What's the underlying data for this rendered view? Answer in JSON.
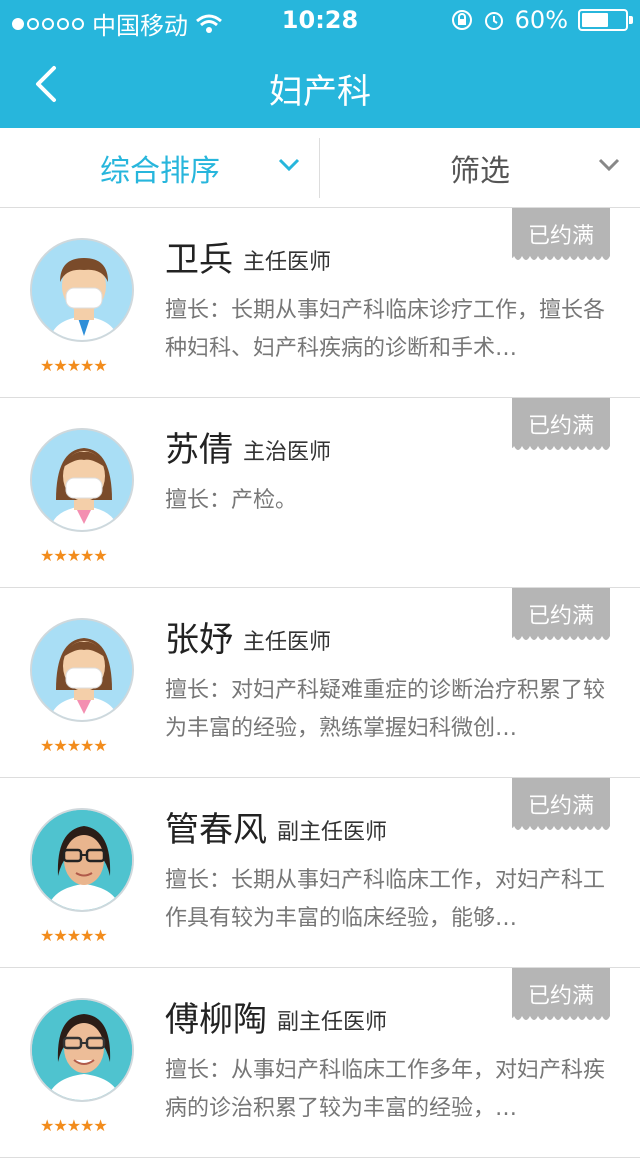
{
  "status_bar": {
    "carrier": "中国移动",
    "time": "10:28",
    "battery": "60%"
  },
  "nav": {
    "title": "妇产科"
  },
  "filters": {
    "sort_label": "综合排序",
    "filter_label": "筛选"
  },
  "doctors": [
    {
      "name": "卫兵",
      "rank": "主任医师",
      "skill": "擅长：长期从事妇产科临床诊疗工作，擅长各种妇科、妇产科疾病的诊断和手术…",
      "badge": "已约满",
      "stars": "★★★★★"
    },
    {
      "name": "苏倩",
      "rank": "主治医师",
      "skill": "擅长：产检。",
      "badge": "已约满",
      "stars": "★★★★★"
    },
    {
      "name": "张妤",
      "rank": "主任医师",
      "skill": "擅长：对妇产科疑难重症的诊断治疗积累了较为丰富的经验，熟练掌握妇科微创…",
      "badge": "已约满",
      "stars": "★★★★★"
    },
    {
      "name": "管春风",
      "rank": "副主任医师",
      "skill": "擅长：长期从事妇产科临床工作，对妇产科工作具有较为丰富的临床经验，能够…",
      "badge": "已约满",
      "stars": "★★★★★"
    },
    {
      "name": "傅柳陶",
      "rank": "副主任医师",
      "skill": "擅长：从事妇产科临床工作多年，对妇产科疾病的诊治积累了较为丰富的经验，…",
      "badge": "已约满",
      "stars": "★★★★★"
    }
  ],
  "colors": {
    "accent": "#27b6dc",
    "star": "#f28c1c",
    "badge": "#b5b5b5"
  }
}
